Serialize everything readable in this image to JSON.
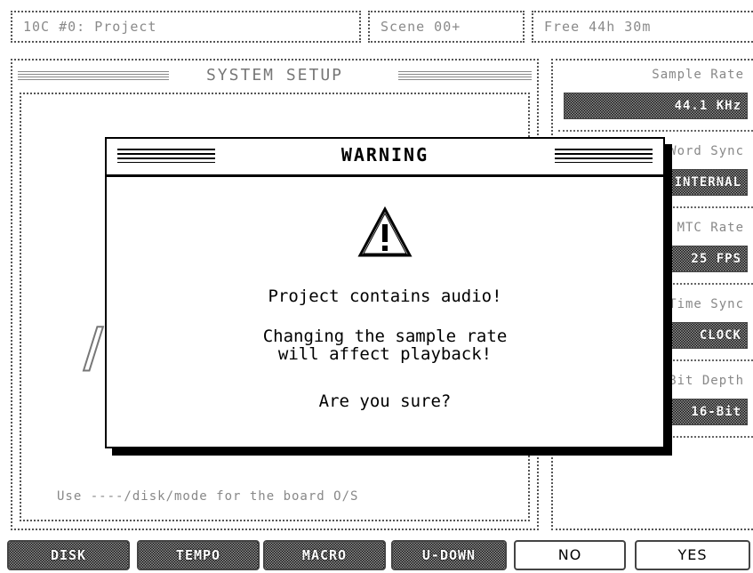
{
  "status_bar": {
    "project_field": "10C #0: Project",
    "scene_field": "Scene 00+",
    "free_field": "Free 44h 30m"
  },
  "setup_panel": {
    "title": "SYSTEM SETUP",
    "hint": "Use ----/disk/mode for the board O/S"
  },
  "right_column": {
    "items": [
      {
        "label": "Sample Rate",
        "value": "44.1 KHz"
      },
      {
        "label": "Word Sync",
        "value": "INTERNAL"
      },
      {
        "label": "MTC Rate",
        "value": "25 FPS"
      },
      {
        "label": "Time Sync",
        "value": "CLOCK"
      },
      {
        "label": "Bit Depth",
        "value": "16-Bit"
      }
    ]
  },
  "softkeys": {
    "disk": "DISK",
    "tempo": "TEMPO",
    "macro": "MACRO",
    "undo": "U-DOWN",
    "no": "NO",
    "yes": "YES"
  },
  "dialog": {
    "title": "WARNING",
    "line1": "Project contains audio!",
    "line2": "Changing the sample rate",
    "line3": "will affect playback!",
    "line4": "Are you sure?",
    "icon": "warning-triangle-icon"
  }
}
